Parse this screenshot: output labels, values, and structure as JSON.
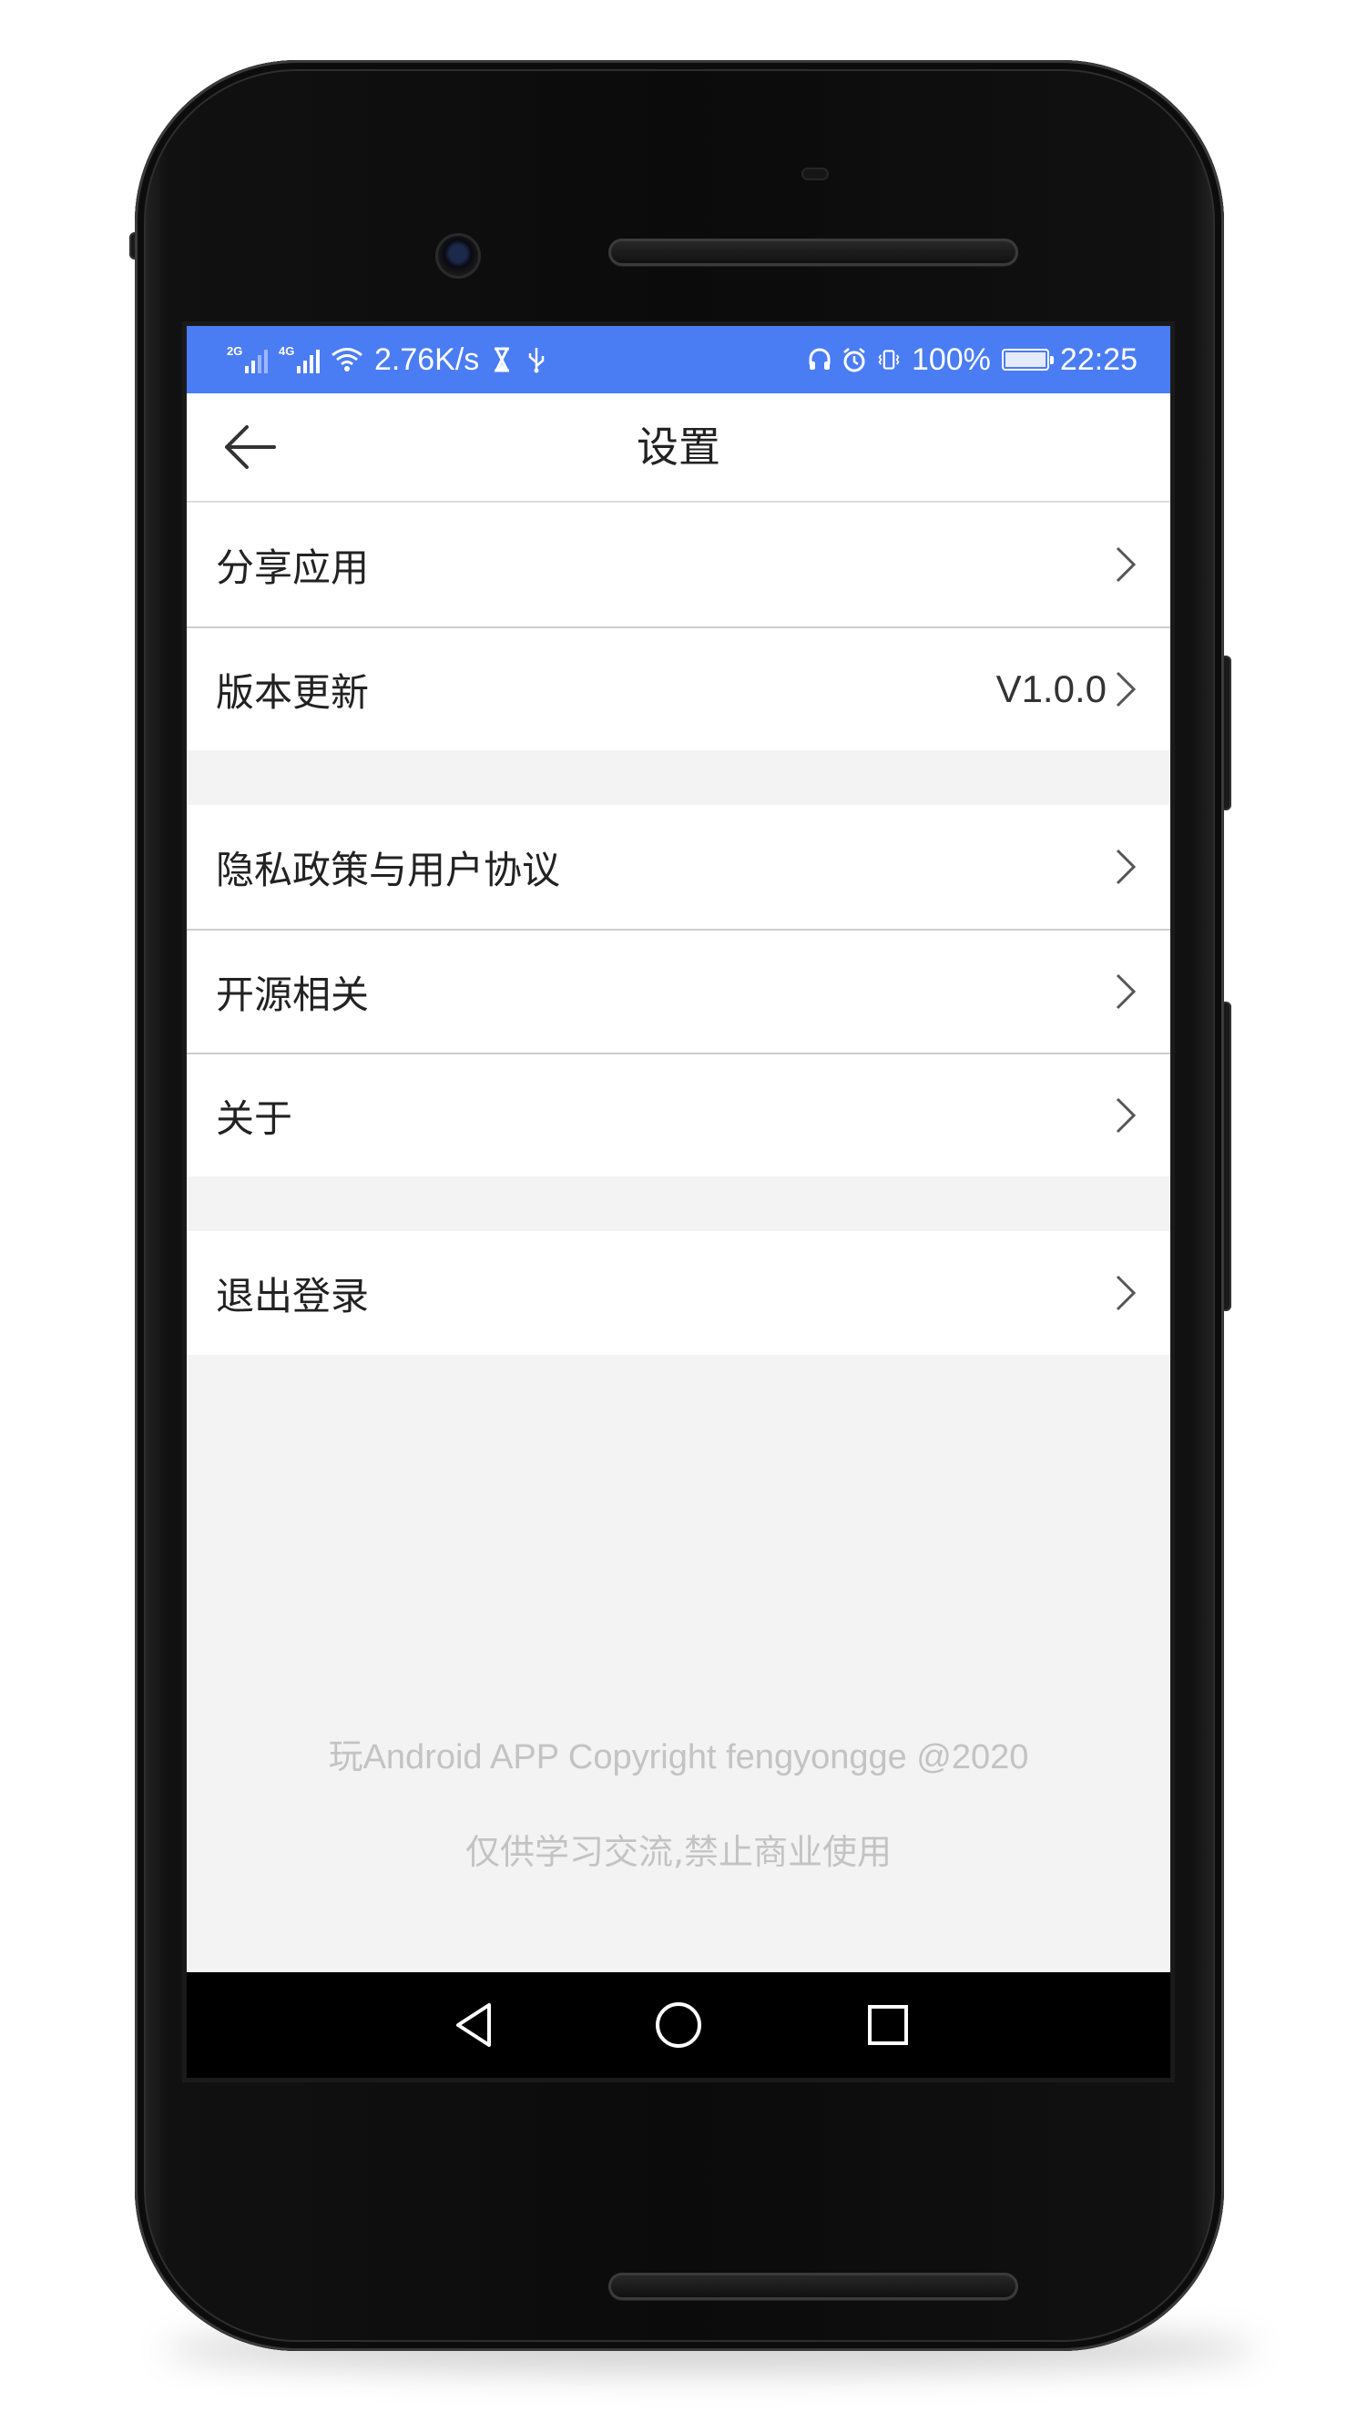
{
  "status_bar": {
    "sim1_type": "2G",
    "sim2_type": "4G",
    "net_speed": "2.76K/s",
    "battery": "100%",
    "time": "22:25",
    "icons": [
      "signal-icon",
      "signal-icon",
      "wifi-icon",
      "hourglass-icon",
      "usb-icon",
      "headset-icon",
      "alarm-icon",
      "vibrate-icon",
      "battery-charging-icon"
    ],
    "bg_color": "#4a7cf3"
  },
  "toolbar": {
    "title": "设置",
    "back_icon": "arrow-left-icon"
  },
  "settings": {
    "share_app": "分享应用",
    "version_update": "版本更新",
    "version": "V1.0.0",
    "privacy_policy": "隐私政策与用户协议",
    "open_source": "开源相关",
    "about": "关于",
    "logout": "退出登录",
    "chevron_icon": "chevron-right-icon"
  },
  "footer": {
    "copyright": "玩Android APP Copyright fengyongge @2020",
    "note": "仅供学习交流,禁止商业使用"
  },
  "nav_bar": {
    "icons": [
      "back-triangle-icon",
      "home-circle-icon",
      "recents-square-icon"
    ]
  }
}
